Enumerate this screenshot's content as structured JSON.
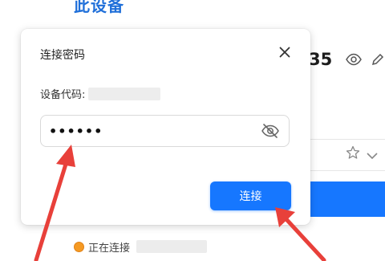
{
  "background": {
    "title": "此设备",
    "device_code_partial": "35",
    "status_text": "正在连接"
  },
  "dialog": {
    "title": "连接密码",
    "device_code_label": "设备代码:",
    "password_value": "••••••",
    "connect_label": "连接"
  },
  "colors": {
    "accent": "#1677ff",
    "title_blue": "#1f6fd9",
    "status_orange": "#f59a23",
    "annotation_red": "#e8403a"
  }
}
